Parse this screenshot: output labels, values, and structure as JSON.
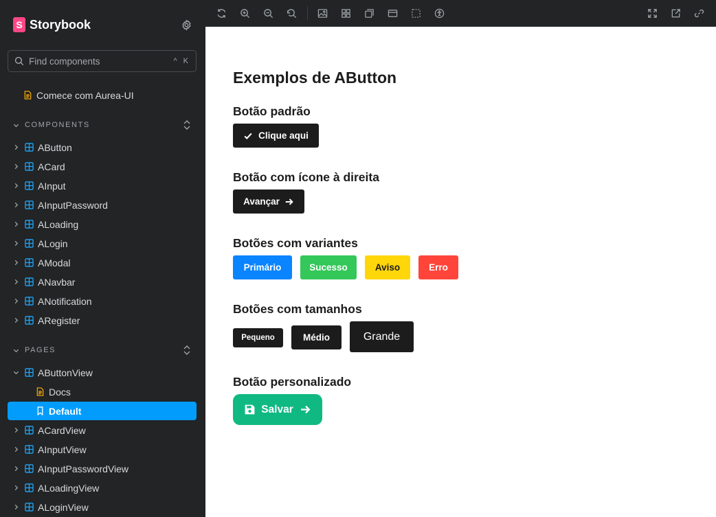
{
  "sidebar": {
    "brand": "Storybook",
    "brand_logo_letter": "S",
    "search": {
      "placeholder": "Find components",
      "shortcut": "^ K"
    },
    "intro": "Comece com Aurea-UI",
    "components_header": "COMPONENTS",
    "components": [
      "AButton",
      "ACard",
      "AInput",
      "AInputPassword",
      "ALoading",
      "ALogin",
      "AModal",
      "ANavbar",
      "ANotification",
      "ARegister"
    ],
    "pages_header": "PAGES",
    "pages": {
      "expanded": "AButtonView",
      "docs": "Docs",
      "selected": "Default",
      "rest": [
        "ACardView",
        "AInputView",
        "AInputPasswordView",
        "ALoadingView",
        "ALoginView"
      ]
    }
  },
  "toolbar": {
    "left_icons": [
      "remount-icon",
      "zoom-in-icon",
      "zoom-out-icon",
      "zoom-reset-icon",
      "background-icon",
      "grid-icon",
      "viewport-icon",
      "measure-icon",
      "outline-icon",
      "accessibility-icon"
    ],
    "right_icons": [
      "fullscreen-icon",
      "open-new-tab-icon",
      "copy-link-icon"
    ]
  },
  "canvas": {
    "title": "Exemplos de AButton",
    "sections": {
      "default": {
        "title": "Botão padrão",
        "button": "Clique aqui"
      },
      "right_icon": {
        "title": "Botão com ícone à direita",
        "button": "Avançar"
      },
      "variants": {
        "title": "Botões com variantes",
        "primary": "Primário",
        "success": "Sucesso",
        "warning": "Aviso",
        "error": "Erro"
      },
      "sizes": {
        "title": "Botões com tamanhos",
        "small": "Pequeno",
        "medium": "Médio",
        "large": "Grande"
      },
      "custom": {
        "title": "Botão personalizado",
        "button": "Salvar"
      }
    }
  },
  "colors": {
    "sidebar_bg": "#222425",
    "selected_bg": "#029cfd",
    "component_icon": "#1ea7fd",
    "doc_icon": "#ffae00",
    "brand_pink": "#ff4785",
    "dark_button": "#1c1c1c",
    "primary": "#0a84ff",
    "success": "#34c759",
    "warning": "#ffd60a",
    "error": "#ff453a",
    "custom": "#10b981"
  }
}
